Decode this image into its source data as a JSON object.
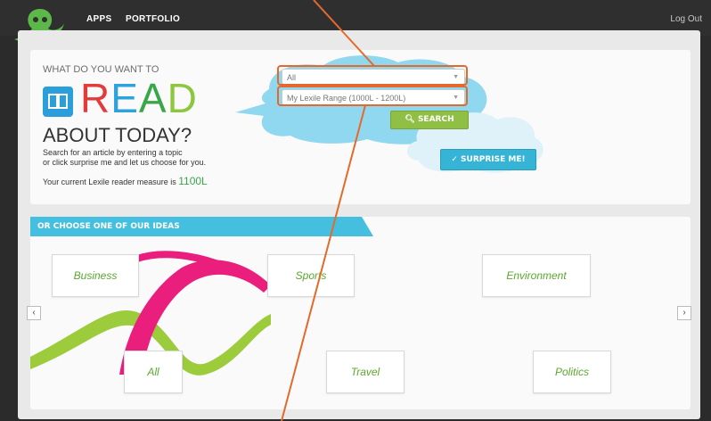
{
  "topbar": {
    "apps_label": "APPS",
    "portfolio_label": "PORTFOLIO",
    "logout_label": "Log Out",
    "logo_icon": "octopus-logo-icon"
  },
  "hero": {
    "ask_text": "WHAT DO YOU WANT TO",
    "read_letters": [
      "R",
      "E",
      "A",
      "D"
    ],
    "read_colors": [
      "#e23b3b",
      "#2ea2dd",
      "#3aa64a",
      "#8dc63f"
    ],
    "about_text": "ABOUT TODAY?",
    "help_line1": "Search for an article by entering a topic",
    "help_line2": "or click surprise me and let us choose for you.",
    "measure_prefix": "Your current Lexile reader measure is ",
    "measure_value": "1100L",
    "book_icon": "book-icon"
  },
  "search": {
    "topic_value": "All",
    "range_value": "My Lexile Range (1000L - 1200L)",
    "search_label": "SEARCH",
    "surprise_label": "SURPRISE ME!",
    "search_icon": "search-icon",
    "check_icon": "check-icon"
  },
  "ideas": {
    "heading": "OR CHOOSE ONE OF OUR IDEAS",
    "topics_row1": [
      "Business",
      "Sports",
      "Environment"
    ],
    "topics_row2": [
      "All",
      "Travel",
      "Politics"
    ],
    "prev_icon": "chevron-left-icon",
    "next_icon": "chevron-right-icon"
  },
  "colors": {
    "accent_green": "#3aa64a",
    "highlight": "#e36a2a",
    "search_green": "#8fbf45",
    "surprise_blue": "#35b4d6",
    "cloud_blue": "#8fd8f0"
  }
}
